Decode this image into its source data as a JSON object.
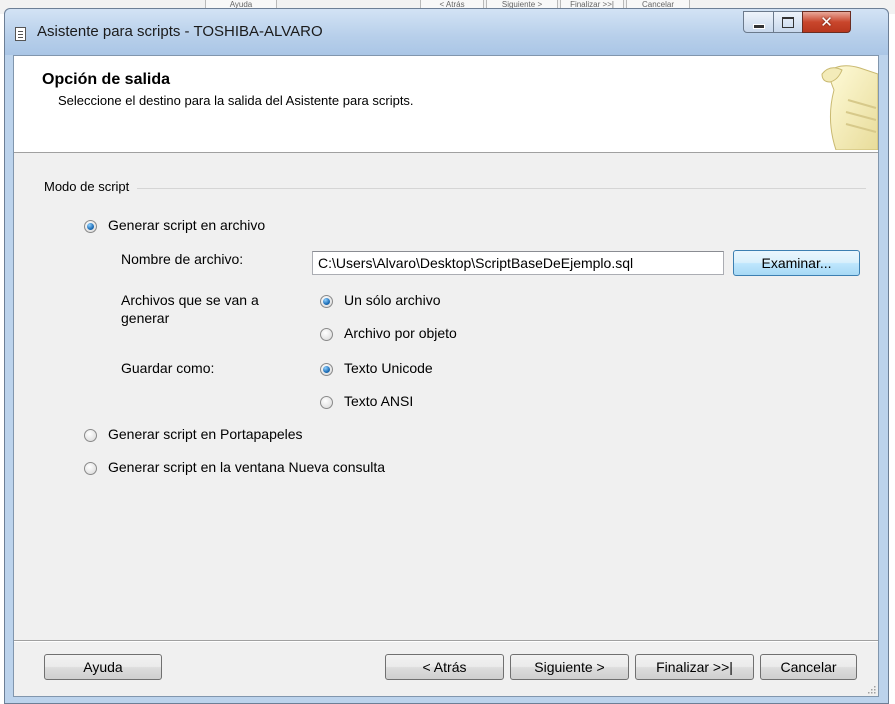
{
  "background_window": {
    "buttons": [
      "Ayuda",
      "< Atrás",
      "Siguiente >",
      "Finalizar >>|",
      "Cancelar"
    ]
  },
  "window": {
    "title": "Asistente para scripts - TOSHIBA-ALVARO",
    "controls": {
      "minimize": "minimize-icon",
      "maximize": "maximize-icon",
      "close": "close-icon"
    }
  },
  "header": {
    "title": "Opción de salida",
    "subtitle": "Seleccione el destino para la salida del Asistente para scripts."
  },
  "group": {
    "label": "Modo de script",
    "options": {
      "file": {
        "label": "Generar script en archivo",
        "checked": true
      },
      "clipboard": {
        "label": "Generar script en Portapapeles",
        "checked": false
      },
      "new_query": {
        "label": "Generar script en la ventana Nueva consulta",
        "checked": false
      }
    }
  },
  "file_settings": {
    "filename_label": "Nombre de archivo:",
    "filename_value": "C:\\Users\\Alvaro\\Desktop\\ScriptBaseDeEjemplo.sql",
    "browse_label": "Examinar...",
    "files_label_line1": "Archivos que se van a",
    "files_label_line2": "generar",
    "files_options": {
      "single": {
        "label": "Un sólo archivo",
        "checked": true
      },
      "per_object": {
        "label": "Archivo por objeto",
        "checked": false
      }
    },
    "save_as_label": "Guardar como:",
    "save_as_options": {
      "unicode": {
        "label": "Texto Unicode",
        "checked": true
      },
      "ansi": {
        "label": "Texto ANSI",
        "checked": false
      }
    }
  },
  "footer": {
    "help": "Ayuda",
    "back": "< Atrás",
    "next": "Siguiente >",
    "finish": "Finalizar >>|",
    "cancel": "Cancelar"
  },
  "colors": {
    "accent": "#1f6fb8",
    "dialog_bg": "#f0f0f0",
    "titlebar": "#b7cfea"
  }
}
